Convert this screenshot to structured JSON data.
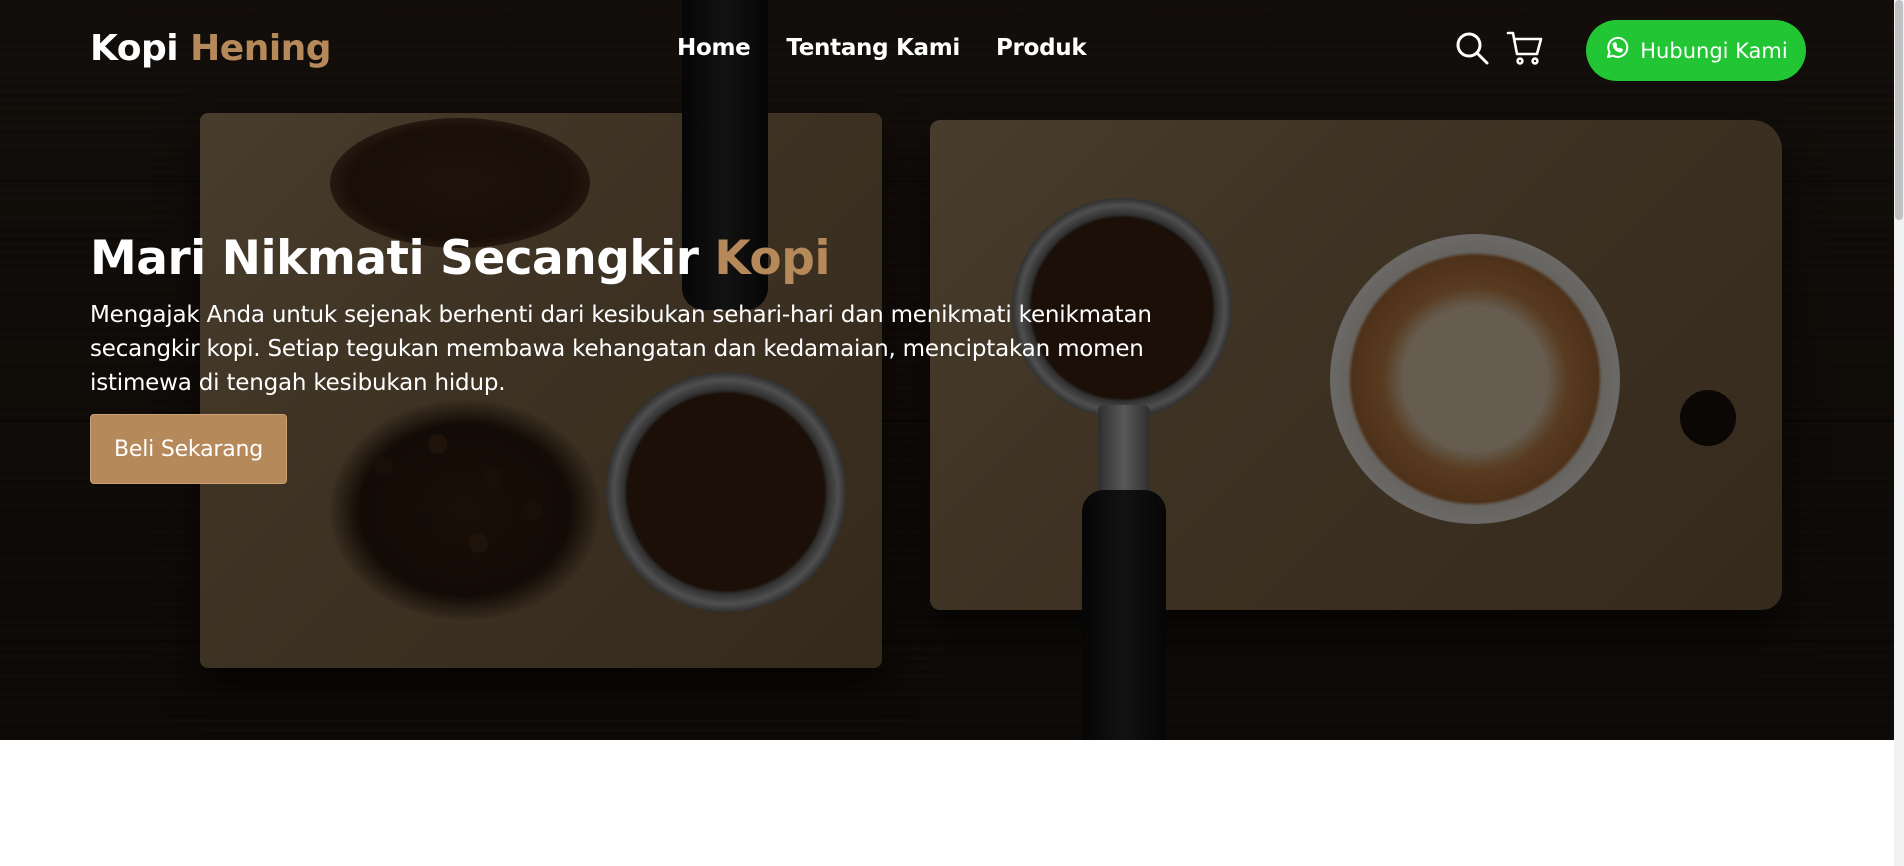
{
  "brand": {
    "first": "Kopi",
    "second": "Hening"
  },
  "nav": {
    "links": [
      {
        "label": "Home"
      },
      {
        "label": "Tentang Kami"
      },
      {
        "label": "Produk"
      }
    ],
    "icons": [
      "search-icon",
      "cart-icon"
    ],
    "cta": {
      "label": "Hubungi Kami",
      "icon": "whatsapp-icon"
    }
  },
  "hero": {
    "title_main": "Mari Nikmati Secangkir",
    "title_accent": "Kopi",
    "description": "Mengajak Anda untuk sejenak berhenti dari kesibukan sehari-hari dan menikmati kenikmatan secangkir kopi. Setiap tegukan membawa kehangatan dan kedamaian, menciptakan momen istimewa di tengah kesibukan hidup.",
    "button_label": "Beli Sekarang"
  },
  "colors": {
    "accent": "#b6895a",
    "whatsapp_green": "#22c533",
    "text": "#ffffff",
    "background": "#ffffff"
  }
}
